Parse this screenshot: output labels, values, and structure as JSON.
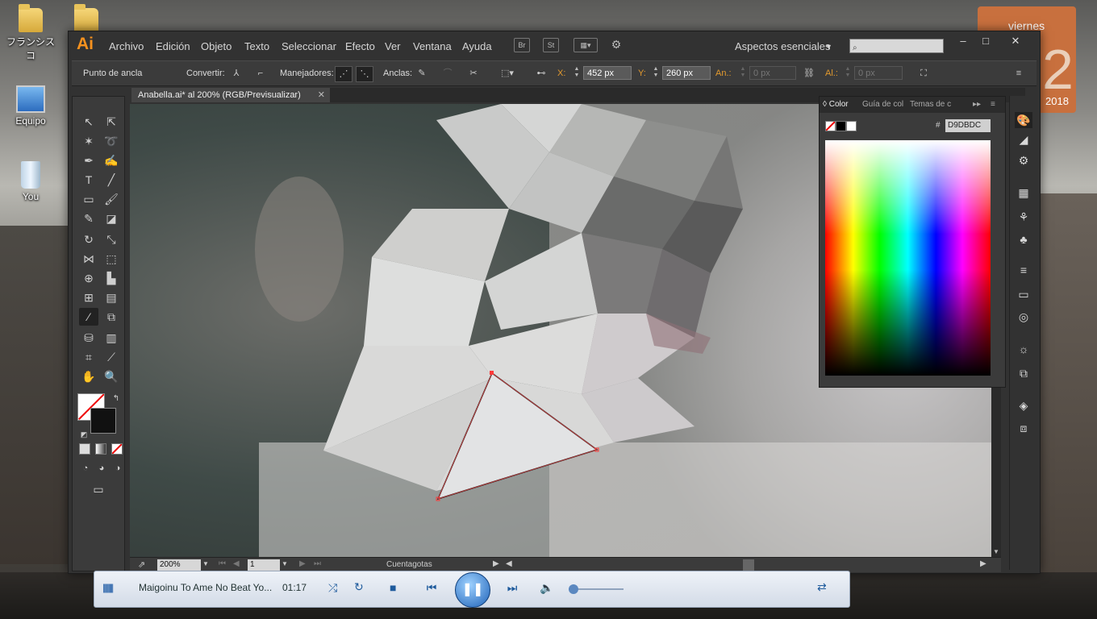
{
  "desktop": {
    "icons": [
      {
        "label": "フランシスコ"
      },
      {
        "label": "Equipo"
      },
      {
        "label": "You"
      }
    ],
    "calendar": {
      "day": "viernes",
      "date": "2",
      "year": "2018"
    }
  },
  "illustrator": {
    "logo": "Ai",
    "menu": [
      "Archivo",
      "Edición",
      "Objeto",
      "Texto",
      "Seleccionar",
      "Efecto",
      "Ver",
      "Ventana",
      "Ayuda"
    ],
    "bridge_buttons": [
      "Br",
      "St"
    ],
    "workspace": "Aspectos esenciales",
    "search_placeholder": "",
    "window_buttons": [
      "–",
      "□",
      "✕"
    ],
    "control_bar": {
      "anchor_label": "Punto de ancla",
      "convert_label": "Convertir:",
      "handles_label": "Manejadores:",
      "anchors_label": "Anclas:",
      "x_label": "X:",
      "x_value": "452 px",
      "y_label": "Y:",
      "y_value": "260 px",
      "w_label": "An.:",
      "w_value": "0 px",
      "h_label": "Al.:",
      "h_value": "0 px"
    },
    "document_tab": "Anabella.ai* al 200% (RGB/Previsualizar)",
    "color_panel": {
      "tabs": [
        "Color",
        "Guía de col",
        "Temas de c"
      ],
      "hex_label": "#",
      "hex_value": "D9DBDC"
    },
    "status_bar": {
      "zoom": "200%",
      "page": "1",
      "tool": "Cuentagotas"
    }
  },
  "media_player": {
    "title": "Maigoinu To Ame No Beat  Yo...",
    "time": "01:17"
  }
}
